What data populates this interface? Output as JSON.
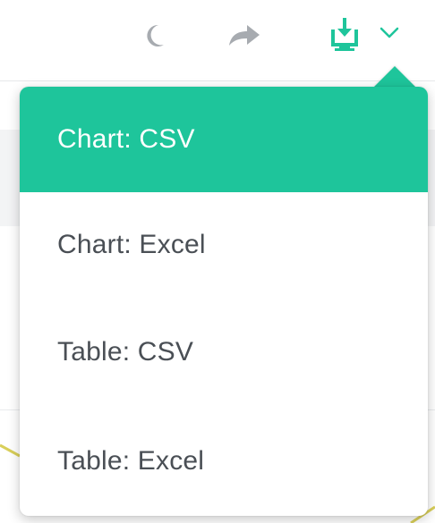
{
  "colors": {
    "accent": "#1ec59b",
    "icon_gray": "#a7abb0",
    "text": "#4a4f55",
    "active_text": "#ffffff"
  },
  "toolbar": {
    "icons": [
      "moon-icon",
      "share-arrow-icon",
      "download-icon",
      "chevron-down-icon"
    ]
  },
  "menu": {
    "items": [
      {
        "label": "Chart: CSV",
        "active": true
      },
      {
        "label": "Chart: Excel",
        "active": false
      },
      {
        "label": "Table: CSV",
        "active": false
      },
      {
        "label": "Table: Excel",
        "active": false
      }
    ]
  }
}
